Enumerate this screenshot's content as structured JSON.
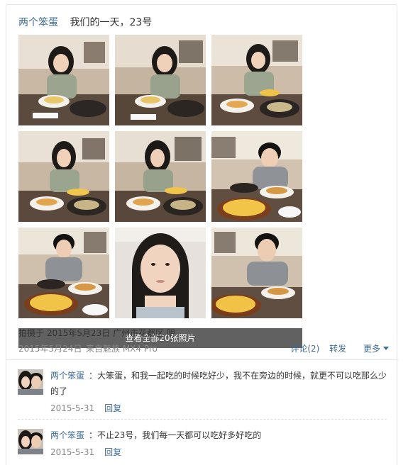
{
  "post": {
    "author": "两个笨蛋",
    "title": "我们的一天，23号",
    "photos": [
      {
        "icon": "photo-girl-drinking"
      },
      {
        "icon": "photo-girl-eating"
      },
      {
        "icon": "photo-girl-with-food"
      },
      {
        "icon": "photo-girl-at-table"
      },
      {
        "icon": "photo-girl-chopsticks"
      },
      {
        "icon": "photo-boy-eating"
      },
      {
        "icon": "photo-boy-smiling"
      },
      {
        "icon": "photo-girl-selfie"
      },
      {
        "icon": "photo-boy-closeup"
      }
    ],
    "view_all": "查看全部20张照片",
    "location_line": "拍摄于 2015年5月23日 广州市花都区 阴",
    "date": "2015年5月24日",
    "source": "来自魅族 MX4 Pro",
    "actions": {
      "comment": "评论(2)",
      "forward": "转发",
      "more": "更多"
    }
  },
  "comments": [
    {
      "name": "两个笨蛋",
      "text": "：大笨蛋，和我一起吃的时候吃好少，我不在旁边的时候，就更不可以吃那么少的了",
      "date": "2015-5-31",
      "reply": "回复"
    },
    {
      "name": "两个笨蛋",
      "text": "：不止23号，我们每一天都可以吃好多好吃的",
      "date": "2015-5-31",
      "reply": "回复"
    }
  ],
  "colors": {
    "link": "#3f6c94",
    "muted": "#888888",
    "overlay": "#000000"
  }
}
